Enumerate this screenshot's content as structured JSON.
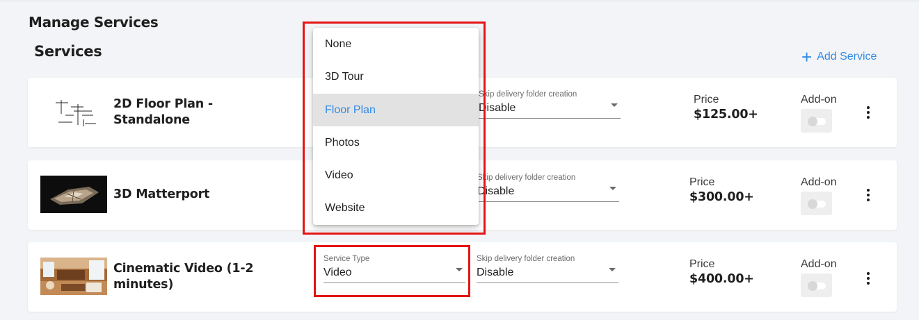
{
  "header": {
    "title": "Manage Services"
  },
  "services_section": {
    "title": "Services",
    "add_label": "Add Service"
  },
  "service_type_dropdown": {
    "options": [
      "None",
      "3D Tour",
      "Floor Plan",
      "Photos",
      "Video",
      "Website"
    ],
    "highlighted": "Floor Plan"
  },
  "services": [
    {
      "name": "2D Floor Plan - Standalone",
      "skip_label": "Skip delivery folder creation",
      "skip_value": "Disable",
      "price_label": "Price",
      "price": "$125.00+",
      "addon_label": "Add-on",
      "addon_enabled": false
    },
    {
      "name": "3D Matterport",
      "skip_label": "Skip delivery folder creation",
      "skip_value": "Disable",
      "price_label": "Price",
      "price": "$300.00+",
      "addon_label": "Add-on",
      "addon_enabled": false
    },
    {
      "name": "Cinematic Video (1-2 minutes)",
      "service_type_label": "Service Type",
      "service_type_value": "Video",
      "skip_label": "Skip delivery folder creation",
      "skip_value": "Disable",
      "price_label": "Price",
      "price": "$400.00+",
      "addon_label": "Add-on",
      "addon_enabled": false
    }
  ],
  "colors": {
    "accent": "#2f8be6",
    "highlight_box": "#e41414",
    "background": "#f3f4f7"
  }
}
